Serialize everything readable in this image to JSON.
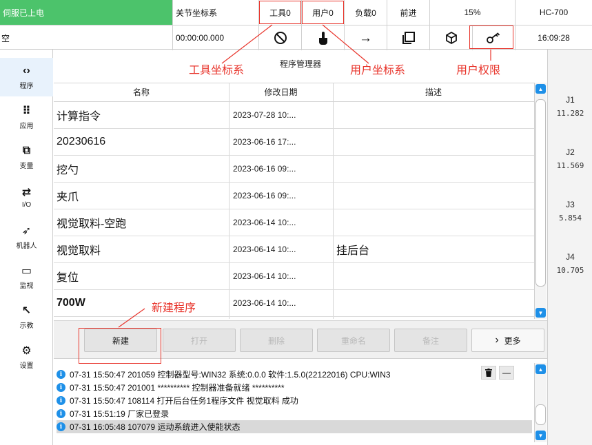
{
  "topbar": {
    "servo_status": "伺服已上电",
    "mode_status": "空",
    "coord_system": "关节坐标系",
    "tool": "工具0",
    "user": "用户0",
    "load": "负载0",
    "direction": "前进",
    "speed": "15%",
    "model": "HC-700",
    "timer": "00:00:00.000",
    "clock": "16:09:28",
    "icons": [
      "prohibit-icon",
      "hand-pointer-icon",
      "arrow-right-icon",
      "copy-square-icon",
      "cube-icon",
      "key-icon"
    ],
    "arrow_glyph": "→"
  },
  "sidebar": {
    "items": [
      {
        "label": "程序",
        "icon": "code-brackets-icon",
        "glyph": "‹›",
        "active": true
      },
      {
        "label": "应用",
        "icon": "grid-icon",
        "glyph": "⠿",
        "active": false
      },
      {
        "label": "变量",
        "icon": "sliders-icon",
        "glyph": "⧉",
        "active": false
      },
      {
        "label": "I/O",
        "icon": "io-arrows-icon",
        "glyph": "⇄",
        "active": false
      },
      {
        "label": "机器人",
        "icon": "robot-arm-icon",
        "glyph": "➶",
        "active": false
      },
      {
        "label": "监视",
        "icon": "monitor-icon",
        "glyph": "▭",
        "active": false
      },
      {
        "label": "示教",
        "icon": "teach-arrow-icon",
        "glyph": "↖",
        "active": false
      },
      {
        "label": "设置",
        "icon": "gear-icon",
        "glyph": "⚙",
        "active": false
      }
    ]
  },
  "main": {
    "title": "程序管理器",
    "columns": {
      "name": "名称",
      "date": "修改日期",
      "desc": "描述"
    },
    "rows": [
      {
        "name": "计算指令",
        "date": "2023-07-28 10:...",
        "desc": ""
      },
      {
        "name": "20230616",
        "date": "2023-06-16 17:...",
        "desc": ""
      },
      {
        "name": "挖勺",
        "date": "2023-06-16 09:...",
        "desc": ""
      },
      {
        "name": "夹爪",
        "date": "2023-06-16 09:...",
        "desc": ""
      },
      {
        "name": "视觉取料-空跑",
        "date": "2023-06-14 10:...",
        "desc": ""
      },
      {
        "name": "视觉取料",
        "date": "2023-06-14 10:...",
        "desc": "挂后台"
      },
      {
        "name": "复位",
        "date": "2023-06-14 10:...",
        "desc": ""
      },
      {
        "name": "700W",
        "date": "2023-06-14 10:...",
        "desc": ""
      }
    ],
    "buttons": {
      "new": "新建",
      "open": "打开",
      "delete": "删除",
      "rename": "重命名",
      "note": "备注",
      "more": "更多",
      "more_glyph": "›"
    }
  },
  "annotations": {
    "tool_coord": "工具坐标系",
    "user_coord": "用户坐标系",
    "user_permission": "用户权限",
    "new_program": "新建程序"
  },
  "joints": [
    {
      "name": "J1",
      "value": "11.282"
    },
    {
      "name": "J2",
      "value": "11.569"
    },
    {
      "name": "J3",
      "value": "5.854"
    },
    {
      "name": "J4",
      "value": "10.705"
    }
  ],
  "log": {
    "entries": [
      "07-31 15:50:47 201059 控制器型号:WIN32 系统:0.0.0 软件:1.5.0(22122016) CPU:WIN3",
      "07-31 15:50:47 201001 ********** 控制器准备就绪 **********",
      "07-31 15:50:47 108114 打开后台任务1程序文件 视觉取料 成功",
      "07-31 15:51:19 厂家已登录",
      "07-31 16:05:48 107079 运动系统进入使能状态"
    ],
    "info_glyph": "i",
    "clear_glyph": "🗑",
    "collapse_glyph": "—"
  },
  "colors": {
    "servo_green": "#4cc36b",
    "accent_blue": "#1e90e8",
    "annotation_red": "#e8332a"
  }
}
